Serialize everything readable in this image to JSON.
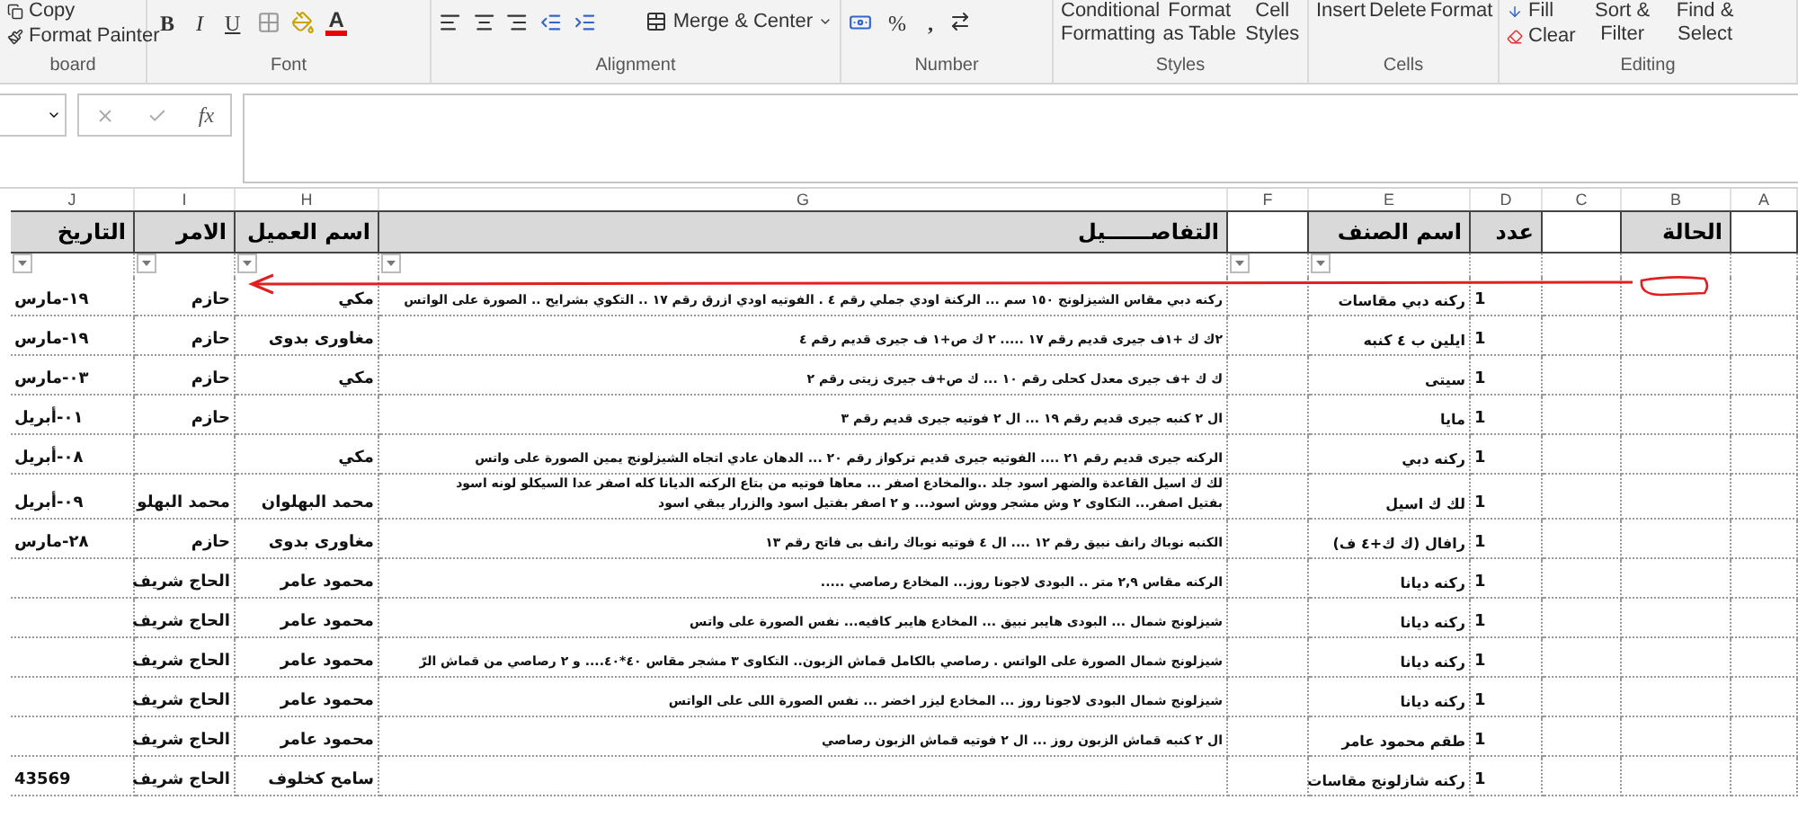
{
  "ribbon": {
    "clipboard": {
      "label": "board",
      "copy": "Copy",
      "format_painter": "Format Painter"
    },
    "font": {
      "label": "Font",
      "bold": "B",
      "italic": "I",
      "underline": "U",
      "font_color": "A"
    },
    "alignment": {
      "label": "Alignment",
      "merge": "Merge & Center"
    },
    "number": {
      "label": "Number",
      "percent": "%",
      "comma": ","
    },
    "styles": {
      "label": "Styles",
      "conditional_formatting": "Conditional Formatting",
      "format_as_table": "Format as Table",
      "cell_styles": "Cell Styles"
    },
    "cells": {
      "label": "Cells",
      "insert": "Insert",
      "delete": "Delete",
      "format": "Format"
    },
    "editing": {
      "label": "Editing",
      "fill": "Fill",
      "clear": "Clear",
      "sort_filter": "Sort & Filter",
      "find_select": "Find & Select"
    }
  },
  "formula_bar": {
    "fx": "fx"
  },
  "sheet": {
    "columns": [
      {
        "letter": "A",
        "filter": false
      },
      {
        "letter": "B",
        "header": "الحالة",
        "filter": false
      },
      {
        "letter": "C",
        "filter": false
      },
      {
        "letter": "D",
        "header": "عدد",
        "filter": false
      },
      {
        "letter": "E",
        "header": "اسم الصنف",
        "filter": true
      },
      {
        "letter": "F",
        "filter": true
      },
      {
        "letter": "G",
        "header": "التفاصــــــيل",
        "filter": true
      },
      {
        "letter": "H",
        "header": "اسم العميل",
        "filter": true
      },
      {
        "letter": "I",
        "header": "الامر",
        "filter": true
      },
      {
        "letter": "J",
        "header": "التاريخ",
        "filter": true
      }
    ],
    "rows": [
      {
        "date": "١٩-مارس",
        "order": "حازم",
        "customer": "مكي",
        "details": "ركنه دبي مقاس الشيزلونج ١٥٠ سم ... الركنة اودي جملي رقم ٤ . الفوتيه اودي ازرق رقم ١٧ .. التكوي بشرايح .. الصورة على الواتس",
        "item": "ركنه دبي مقاسات",
        "count": "1"
      },
      {
        "date": "١٩-مارس",
        "order": "حازم",
        "customer": "مغاورى بدوى",
        "details": "٢ك ك +١ف جيرى قديم رقم ١٧ ..... ٢ ك ص+١ ف جيرى قديم رقم ٤",
        "item": "ايلين ب ٤ كنبه",
        "count": "1"
      },
      {
        "date": "٠٣-مارس",
        "order": "حازم",
        "customer": "مكي",
        "details": "ك ك +ف جيرى معدل كحلى رقم ١٠ ... ك ص+ف جيرى زيتى رقم ٢",
        "item": "سيتى",
        "count": "1"
      },
      {
        "date": "٠١-أبريل",
        "order": "حازم",
        "details": "ال ٢ كنبه جيرى قديم رقم ١٩ ... ال ٢ فوتيه جيرى قديم رقم ٣",
        "item": "مايا",
        "count": "1"
      },
      {
        "date": "٠٨-أبريل",
        "customer": "مكي",
        "details": "الركنه جيرى قديم رقم ٢١ .... الفوتيه جيرى قديم تركواز رقم ٢٠ ... الدهان عادي اتجاه الشيزلونج يمين الصورة على واتس",
        "item": "ركنه دبي",
        "count": "1"
      },
      {
        "date": "٠٩-أبريل",
        "order": "محمد البهلو",
        "customer": "محمد البهلوان",
        "details": "لك ك اسيل القاعدة والضهر اسود جلد ..والمخادع اصفر ... معاها فوتيه من بتاع الركنه الديانا كله اصفر عدا السيكلو لونه اسود\nبفتيل اصفر... التكاوى ٢ وش مشجر ووش اسود... و ٢ اصفر بفتيل اسود والزرار يبقي اسود",
        "item": "لك ك اسيل",
        "count": "1"
      },
      {
        "date": "٢٨-مارس",
        "order": "حازم",
        "customer": "مغاورى بدوى",
        "details": "الكنبه نوباك رانف نبيق رقم ١٢ .... ال ٤ فوتيه نوباك رانف بى فاتح رقم ١٣",
        "item": "رافال (ك ك+٤ ف)",
        "count": "1"
      },
      {
        "order": "الحاج شريف",
        "customer": "محمود عامر",
        "details": "الركنه مقاس ٢,٩ متر .. البودى لاجونا روز... المخادع رصاصي .....",
        "item": "ركنه ديانا",
        "count": "1"
      },
      {
        "order": "الحاج شريف",
        "customer": "محمود عامر",
        "details": "شيزلونج شمال ... البودى هايبر نبيق ... المخادع هايبر كافيه... نفس الصورة على واتس",
        "item": "ركنه ديانا",
        "count": "1"
      },
      {
        "order": "الحاج شريف",
        "customer": "محمود عامر",
        "details": "شيزلونج شمال الصورة على الواتس . رصاصي بالكامل قماش الزبون.. التكاوى ٣ مشجر مقاس ٤٠*٤٠.... و ٢ رصاصي من قماش الرّ",
        "item": "ركنه ديانا",
        "count": "1"
      },
      {
        "order": "الحاج شريف",
        "customer": "محمود عامر",
        "details": "شيزلونج شمال البودى لاجونا روز ... المخادع ليزر اخضر ... نفس الصورة اللى على الواتس",
        "item": "ركنه ديانا",
        "count": "1"
      },
      {
        "order": "الحاج شريف",
        "customer": "محمود عامر",
        "details": "ال ٢ كنبه قماش الزبون روز ... ال ٢ فوتيه قماش الزبون رصاصي",
        "item": "طقم محمود عامر",
        "count": "1"
      },
      {
        "date": "43569",
        "order": "الحاج شريف",
        "customer": "سامح كخلوف",
        "item": "ركنه شازلونج مقاسات",
        "count": "1"
      }
    ]
  }
}
